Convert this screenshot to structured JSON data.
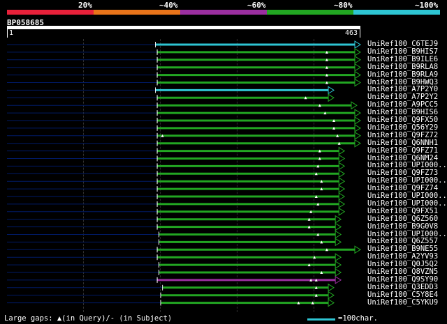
{
  "legend": {
    "labels": [
      "20%",
      "~40%",
      "~60%",
      "~80%",
      "~100%"
    ],
    "colors": [
      "#e8213a",
      "#e8741a",
      "#9b2fa0",
      "#22a622",
      "#2ec5d3"
    ]
  },
  "query": {
    "name": "BP058685",
    "start": "1",
    "end": "463"
  },
  "hits": [
    {
      "name": "UniRef100_C6TEJ9",
      "start": 0.42,
      "end": 1.0,
      "color": "#2ec5d3",
      "gaps": []
    },
    {
      "name": "UniRef100_B9HIS7",
      "start": 0.425,
      "end": 1.0,
      "color": "#22a622",
      "gaps": [
        0.905
      ]
    },
    {
      "name": "UniRef100_B9ILE6",
      "start": 0.425,
      "end": 1.0,
      "color": "#22a622",
      "gaps": [
        0.905
      ]
    },
    {
      "name": "UniRef100_B9RLA8",
      "start": 0.425,
      "end": 1.0,
      "color": "#22a622",
      "gaps": [
        0.905
      ]
    },
    {
      "name": "UniRef100_B9RLA9",
      "start": 0.425,
      "end": 1.0,
      "color": "#22a622",
      "gaps": [
        0.905
      ]
    },
    {
      "name": "UniRef100_B9HWQ3",
      "start": 0.425,
      "end": 1.0,
      "color": "#22a622",
      "gaps": [
        0.905
      ]
    },
    {
      "name": "UniRef100_A7P2Y0",
      "start": 0.42,
      "end": 0.925,
      "color": "#2ec5d3",
      "gaps": []
    },
    {
      "name": "UniRef100_A7P2Y2",
      "start": 0.425,
      "end": 0.925,
      "color": "#22a622",
      "gaps": [
        0.845
      ]
    },
    {
      "name": "UniRef100_A9PCC5",
      "start": 0.425,
      "end": 0.99,
      "color": "#22a622",
      "gaps": [
        0.885
      ]
    },
    {
      "name": "UniRef100_B9HIS6",
      "start": 0.425,
      "end": 1.0,
      "color": "#22a622",
      "gaps": [
        0.9
      ]
    },
    {
      "name": "UniRef100_Q9FX50",
      "start": 0.425,
      "end": 1.0,
      "color": "#22a622",
      "gaps": [
        0.925
      ]
    },
    {
      "name": "UniRef100_Q56Y29",
      "start": 0.425,
      "end": 1.0,
      "color": "#22a622",
      "gaps": [
        0.925
      ]
    },
    {
      "name": "UniRef100_Q9FZ72",
      "start": 0.425,
      "end": 1.0,
      "color": "#22a622",
      "gaps": [
        0.44,
        0.935
      ]
    },
    {
      "name": "UniRef100_Q6NNH1",
      "start": 0.425,
      "end": 1.0,
      "color": "#22a622",
      "gaps": [
        0.94
      ]
    },
    {
      "name": "UniRef100_Q9FZ71",
      "start": 0.425,
      "end": 0.955,
      "color": "#22a622",
      "gaps": [
        0.885
      ]
    },
    {
      "name": "UniRef100_Q6NM24",
      "start": 0.425,
      "end": 0.955,
      "color": "#22a622",
      "gaps": [
        0.885
      ]
    },
    {
      "name": "UniRef100_UPI000..",
      "start": 0.425,
      "end": 0.955,
      "color": "#22a622",
      "gaps": [
        0.88
      ]
    },
    {
      "name": "UniRef100_Q9FZ73",
      "start": 0.425,
      "end": 0.955,
      "color": "#22a622",
      "gaps": [
        0.875
      ]
    },
    {
      "name": "UniRef100_UPI000..",
      "start": 0.425,
      "end": 0.955,
      "color": "#22a622",
      "gaps": [
        0.89
      ]
    },
    {
      "name": "UniRef100_Q9FZ74",
      "start": 0.425,
      "end": 0.955,
      "color": "#22a622",
      "gaps": [
        0.89
      ]
    },
    {
      "name": "UniRef100_UPI000..",
      "start": 0.425,
      "end": 0.955,
      "color": "#22a622",
      "gaps": [
        0.875
      ]
    },
    {
      "name": "UniRef100_UPI000..",
      "start": 0.425,
      "end": 0.955,
      "color": "#22a622",
      "gaps": [
        0.88
      ]
    },
    {
      "name": "UniRef100_Q9FX51",
      "start": 0.425,
      "end": 0.955,
      "color": "#22a622",
      "gaps": [
        0.86
      ]
    },
    {
      "name": "UniRef100_Q6Z560",
      "start": 0.425,
      "end": 0.945,
      "color": "#22a622",
      "gaps": [
        0.855
      ]
    },
    {
      "name": "UniRef100_B9G0V8",
      "start": 0.425,
      "end": 0.945,
      "color": "#22a622",
      "gaps": [
        0.855
      ]
    },
    {
      "name": "UniRef100_UPI000..",
      "start": 0.43,
      "end": 0.945,
      "color": "#22a622",
      "gaps": [
        0.88
      ]
    },
    {
      "name": "UniRef100_Q6Z557",
      "start": 0.43,
      "end": 0.945,
      "color": "#22a622",
      "gaps": [
        0.89
      ]
    },
    {
      "name": "UniRef100_B9NE55",
      "start": 0.425,
      "end": 1.0,
      "color": "#22a622",
      "gaps": [
        0.905
      ]
    },
    {
      "name": "UniRef100_A2YV93",
      "start": 0.425,
      "end": 0.945,
      "color": "#22a622",
      "gaps": [
        0.87
      ]
    },
    {
      "name": "UniRef100_Q0J5Q2",
      "start": 0.43,
      "end": 0.945,
      "color": "#22a622",
      "gaps": [
        0.855
      ]
    },
    {
      "name": "UniRef100_Q8VZN5",
      "start": 0.43,
      "end": 0.945,
      "color": "#22a622",
      "gaps": [
        0.89
      ]
    },
    {
      "name": "UniRef100_Q9SY90",
      "start": 0.425,
      "end": 0.945,
      "color": "#9b2fa0",
      "gaps": [
        0.86,
        0.875
      ]
    },
    {
      "name": "UniRef100_Q3EDD3",
      "start": 0.44,
      "end": 0.925,
      "color": "#22a622",
      "gaps": [
        0.875
      ]
    },
    {
      "name": "UniRef100_C5Y8E4",
      "start": 0.435,
      "end": 0.925,
      "color": "#22a622",
      "gaps": [
        0.875
      ]
    },
    {
      "name": "UniRef100_C5YKU9",
      "start": 0.435,
      "end": 0.925,
      "color": "#22a622",
      "gaps": [
        0.825,
        0.865
      ]
    }
  ],
  "footer": {
    "gaps_text": "Large gaps: ▲(in Query)/- (in Subject)",
    "scale_text": "=100char."
  },
  "colors": {
    "background": "#000000",
    "guide": "#001a66",
    "text": "#ffffff"
  }
}
